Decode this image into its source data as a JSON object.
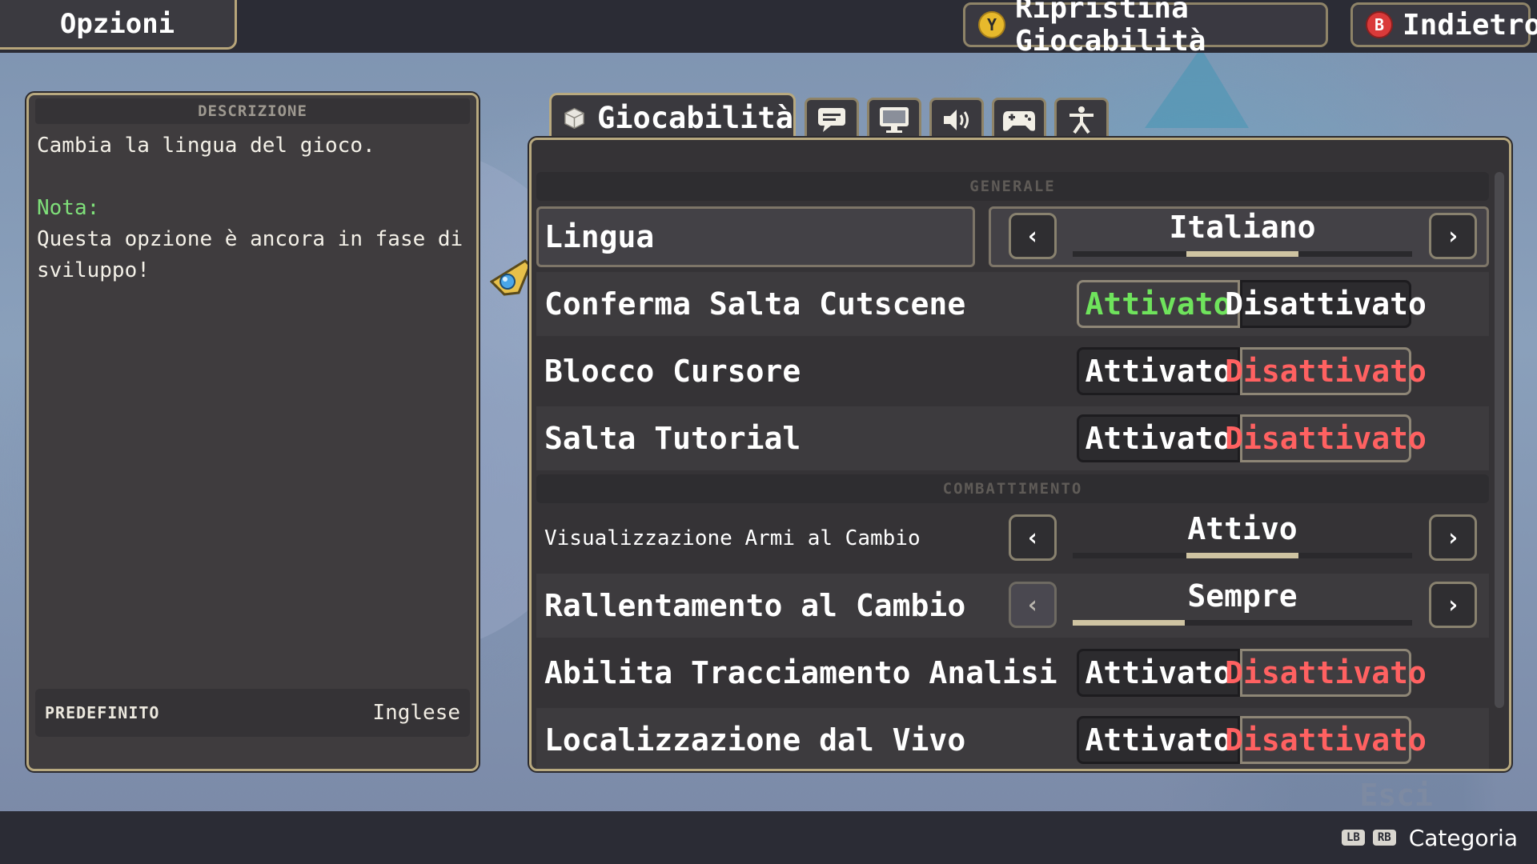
{
  "header": {
    "title": "Opzioni",
    "reset_key": "Y",
    "reset_label": "Ripristina Giocabilità",
    "back_key": "B",
    "back_label": "Indietro"
  },
  "description_panel": {
    "header": "DESCRIZIONE",
    "text": "Cambia la lingua del gioco.",
    "note_label": "Nota:",
    "note_text": "Questa opzione è ancora in fase di sviluppo!",
    "default_label": "PREDEFINITO",
    "default_value": "Inglese"
  },
  "tabs": {
    "active_label": "Giocabilità",
    "icons": [
      "gameplay-cube-icon",
      "chat-bubble-icon",
      "monitor-icon",
      "speaker-icon",
      "gamepad-icon",
      "accessibility-icon"
    ]
  },
  "sections": {
    "general": "GENERALE",
    "combat": "COMBATTIMENTO"
  },
  "options": {
    "lingua": {
      "label": "Lingua",
      "value": "Italiano",
      "position": 0.5
    },
    "conferma": {
      "label": "Conferma Salta Cutscene",
      "on": "Attivato",
      "off": "Disattivato",
      "selected": "on"
    },
    "blocco": {
      "label": "Blocco Cursore",
      "on": "Attivato",
      "off": "Disattivato",
      "selected": "off"
    },
    "tutorial": {
      "label": "Salta Tutorial",
      "on": "Attivato",
      "off": "Disattivato",
      "selected": "off"
    },
    "armi": {
      "label": "Visualizzazione Armi al Cambio",
      "value": "Attivo",
      "position": 0.5
    },
    "rallentamento": {
      "label": "Rallentamento al Cambio",
      "value": "Sempre",
      "position": 0.0
    },
    "tracciamento": {
      "label": "Abilita Tracciamento Analisi",
      "on": "Attivato",
      "off": "Disattivato",
      "selected": "off"
    },
    "localizzazione": {
      "label": "Localizzazione dal Vivo",
      "on": "Attivato",
      "off": "Disattivato",
      "selected": "off"
    }
  },
  "arrows": {
    "left": "‹",
    "right": "›"
  },
  "footer": {
    "exit_label": "Esci",
    "lb_key": "LB",
    "rb_key": "RB",
    "category_label": "Categoria"
  },
  "colors": {
    "accent_border": "#b8a97f",
    "active_green": "#6fe35c",
    "inactive_red": "#ff6161",
    "note_green": "#7fe07a"
  }
}
